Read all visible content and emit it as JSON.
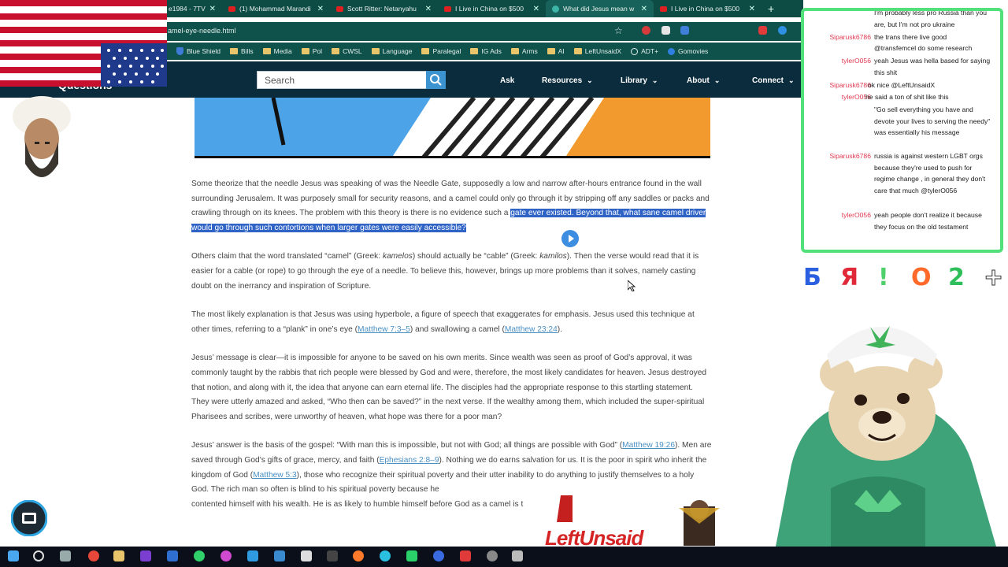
{
  "browser": {
    "tabs": [
      {
        "label": "e1984 - 7TV",
        "kind": "twitch"
      },
      {
        "label": "(1) Mohammad Marandi",
        "kind": "youtube"
      },
      {
        "label": "Scott Ritter: Netanyahu",
        "kind": "youtube"
      },
      {
        "label": "I Live in China on $500",
        "kind": "youtube"
      },
      {
        "label": "What did Jesus mean w",
        "kind": "page",
        "active": true
      },
      {
        "label": "I Live in China on $500",
        "kind": "youtube"
      }
    ],
    "new_tab": "+",
    "url": "amel-eye-needle.html",
    "bookmarks": [
      "Blue Shield",
      "Bills",
      "Media",
      "Pol",
      "CWSL",
      "Language",
      "Paralegal",
      "IG Ads",
      "Arms",
      "AI",
      "LeftUnsaidX",
      "ADT+",
      "Gomovies"
    ]
  },
  "site_nav": {
    "search_placeholder": "Search",
    "links": [
      "Ask",
      "Resources",
      "Library",
      "About",
      "Connect"
    ],
    "questions_label": "Questions"
  },
  "article": {
    "p1_a": "Some theorize that the needle Jesus was speaking of was the Needle Gate, supposedly a low and narrow after-hours entrance found in the wall surrounding Jerusalem. It was purposely small for security reasons, and a camel could only go through it by stripping off any saddles or packs and crawling through on its knees. The problem with this theory is there is no evidence such a ",
    "p1_highlight": "gate ever existed. Beyond that, what sane camel driver would go through such contortions when larger gates were easily accessible?",
    "p2_a": "Others claim that the word translated “camel” (Greek: ",
    "p2_b": "kamelos",
    "p2_c": ") should actually be “cable” (Greek: ",
    "p2_d": "kamilos",
    "p2_e": "). Then the verse would read that it is easier for a cable (or rope) to go through the eye of a needle. To believe this, however, brings up more problems than it solves, namely casting doubt on the inerrancy and inspiration of Scripture.",
    "p3_a": "The most likely explanation is that Jesus was using hyperbole, a figure of speech that exaggerates for emphasis. Jesus used this technique at other times, referring to a “plank” in one’s eye (",
    "p3_ref1": "Matthew 7:3–5",
    "p3_b": ") and swallowing a camel (",
    "p3_ref2": "Matthew 23:24",
    "p3_c": ").",
    "p4": "Jesus’ message is clear—it is impossible for anyone to be saved on his own merits. Since wealth was seen as proof of God’s approval, it was commonly taught by the rabbis that rich people were blessed by God and were, therefore, the most likely candidates for heaven. Jesus destroyed that notion, and along with it, the idea that anyone can earn eternal life. The disciples had the appropriate response to this startling statement. They were utterly amazed and asked, “Who then can be saved?” in the next verse. If the wealthy among them, which included the super-spiritual Pharisees and scribes, were unworthy of heaven, what hope was there for a poor man?",
    "p5_a": "Jesus’ answer is the basis of the gospel: “With man this is impossible, but not with God; all things are possible with God” (",
    "p5_ref1": "Matthew 19:26",
    "p5_b": "). Men are saved through God’s gifts of grace, mercy, and faith (",
    "p5_ref2": "Ephesians 2:8–9",
    "p5_c": "). Nothing we do earns salvation for us. It is the poor in spirit who inherit the kingdom of God (",
    "p5_ref3": "Matthew 5:3",
    "p5_d": "), those who recognize their spiritual poverty and their utter inability to do anything to justify themselves to a holy God. The rich man so often is blind to his spiritual poverty because he ",
    "p5_e": "contented himself with his wealth. He is as likely to humble himself before God as a camel is t"
  },
  "chat": {
    "messages": [
      {
        "user": "",
        "text": "I'm probably less pro Russia than you are, but I'm not pro ukraine"
      },
      {
        "user": "Siparusk6786",
        "text": "the trans there live good"
      },
      {
        "user": "",
        "text": "@transfemcel do some research"
      },
      {
        "user": "tylerO056",
        "text": "yeah Jesus was hella based for saying this shit"
      },
      {
        "user": "Siparusk6786",
        "text": "ok nice @LeftUnsaidX"
      },
      {
        "user": "tylerO056",
        "text": "he said a ton of shit like this"
      },
      {
        "user": "",
        "text": "\"Go sell everything you have and devote your lives to serving the needy\" was essentially his message"
      },
      {
        "user": "Siparusk6786",
        "text": "russia is against western LGBT orgs because they're used to push for regime change , in general they don't care that much @tylerO056"
      },
      {
        "user": "tylerO056",
        "text": "yeah people don't realize it because they focus on the old testament"
      }
    ]
  },
  "overlay": {
    "glyphs": [
      "Б",
      "Я",
      "!",
      "O",
      "2",
      "+"
    ],
    "logo_text": "LeftUnsaid"
  },
  "colors": {
    "tab_bar": "#0d4b45",
    "site_nav": "#0b2c3d",
    "highlight": "#2f63c6",
    "link": "#4a8fc2",
    "chat_border": "#52e07a",
    "chat_user": "#e23a52"
  }
}
